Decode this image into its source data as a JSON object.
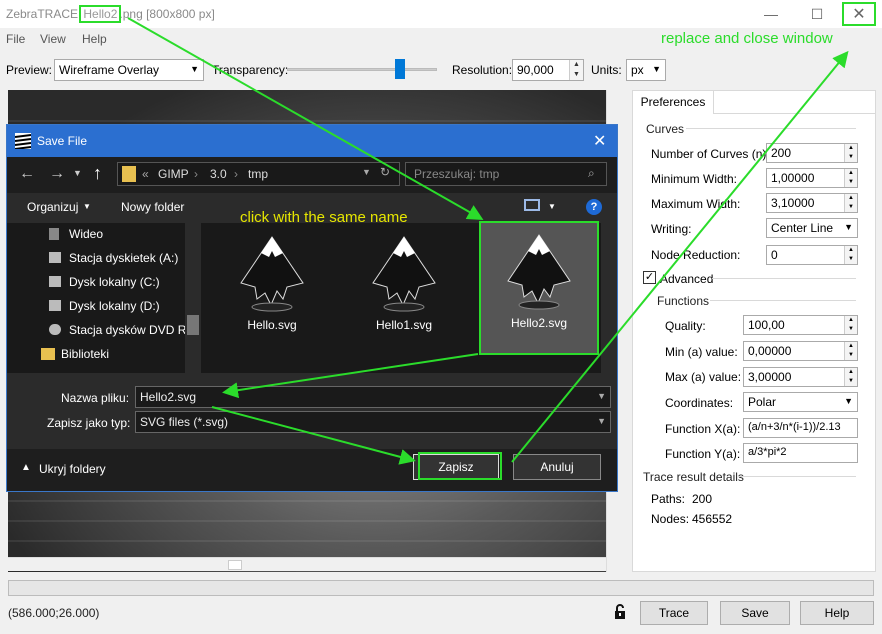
{
  "window": {
    "app": "ZebraTRACE",
    "file_highlight": "Hello2",
    "file_rest": ".png [800x800 px]"
  },
  "menu": [
    "File",
    "View",
    "Help"
  ],
  "toolbar": {
    "preview_label": "Preview:",
    "preview_value": "Wireframe Overlay",
    "transparency_label": "Transparency:",
    "transparency_level": 0.75,
    "resolution_label": "Resolution:",
    "resolution_value": "90,000",
    "units_label": "Units:",
    "units_value": "px"
  },
  "prefs": {
    "tab": "Preferences",
    "curves_group": "Curves",
    "number_of_curves_label": "Number of Curves (n):",
    "number_of_curves": "200",
    "min_width_label": "Minimum Width:",
    "min_width": "1,00000",
    "max_width_label": "Maximum Width:",
    "max_width": "3,10000",
    "writing_label": "Writing:",
    "writing": "Center Line",
    "node_reduction_label": "Node Reduction:",
    "node_reduction": "0",
    "advanced_label": "Advanced",
    "advanced_checked": true,
    "functions_group": "Functions",
    "quality_label": "Quality:",
    "quality": "100,00",
    "min_a_label": "Min (a) value:",
    "min_a": "0,00000",
    "max_a_label": "Max (a) value:",
    "max_a": "3,00000",
    "coords_label": "Coordinates:",
    "coords": "Polar",
    "fx_label": "Function X(a):",
    "fx": "(a/n+3/n*(i-1))/2.13",
    "fy_label": "Function Y(a):",
    "fy": "a/3*pi*2",
    "result_group": "Trace result details",
    "paths_label": "Paths:",
    "paths": "200",
    "nodes_label": "Nodes:",
    "nodes": "456552"
  },
  "status": {
    "coords": "(586.000;26.000)"
  },
  "buttons": {
    "trace": "Trace",
    "save": "Save",
    "help": "Help"
  },
  "dialog": {
    "title": "Save File",
    "breadcrumb": [
      "«",
      "GIMP",
      "3.0",
      "tmp"
    ],
    "search_placeholder": "Przeszukaj: tmp",
    "organize": "Organizuj",
    "new_folder": "Nowy folder",
    "tree": [
      "Wideo",
      "Stacja dyskietek (A:)",
      "Dysk lokalny (C:)",
      "Dysk lokalny (D:)",
      "Stacja dysków DVD R\\",
      "Biblioteki"
    ],
    "files": [
      "Hello.svg",
      "Hello1.svg",
      "Hello2.svg"
    ],
    "filename_label": "Nazwa pliku:",
    "filename": "Hello2.svg",
    "type_label": "Zapisz jako typ:",
    "type": "SVG files (*.svg)",
    "hide_folders": "Ukryj foldery",
    "save": "Zapisz",
    "cancel": "Anuluj"
  },
  "annotations": {
    "close": "replace and close window",
    "same_name": "click with the same name"
  },
  "colors": {
    "annotation_green": "#2bdc2b",
    "annotation_yellow": "#e6e600",
    "dialog_title": "#2b6fd0"
  }
}
